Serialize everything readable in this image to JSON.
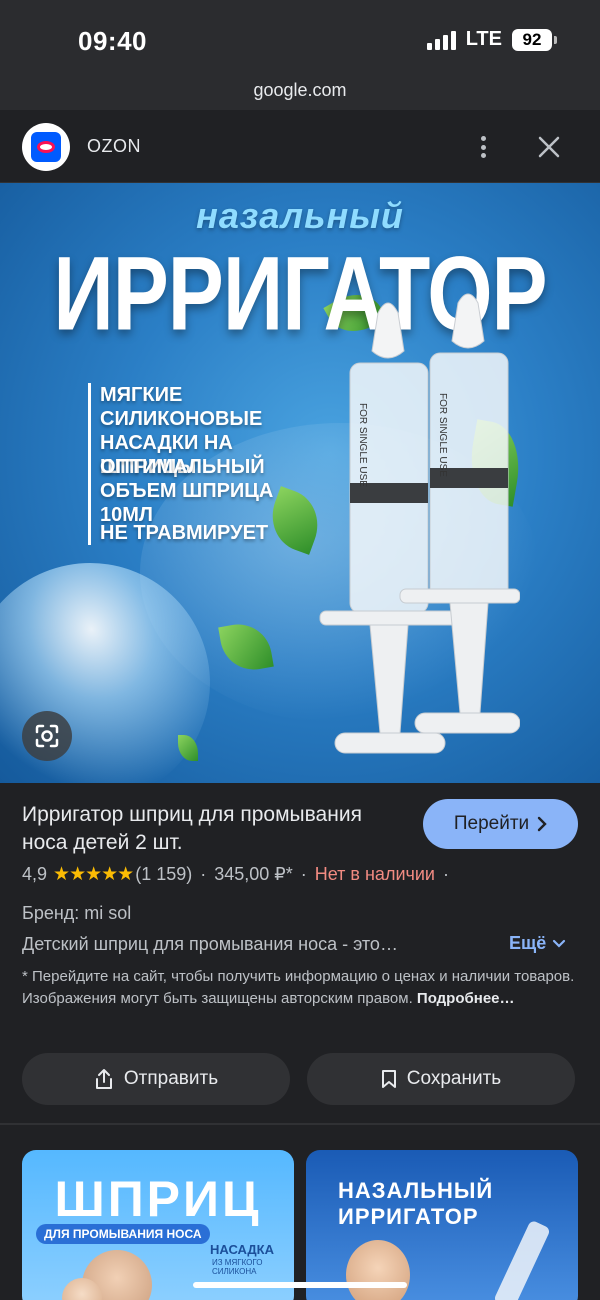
{
  "status_bar": {
    "time": "09:40",
    "network": "LTE",
    "battery": "92"
  },
  "browser": {
    "url": "google.com"
  },
  "header": {
    "site_name": "OZON"
  },
  "hero": {
    "subtitle": "назальный",
    "title": "ИРРИГАТОР",
    "features": [
      "МЯГКИЕ СИЛИКОНОВЫЕ НАСАДКИ НА ШПРИЦЫ",
      "ОПТИМАЛЬНЫЙ ОБЪЕМ ШПРИЦА 10МЛ",
      "НЕ ТРАВМИРУЕТ"
    ],
    "syringe_text": "FOR SINGLE USE"
  },
  "product": {
    "title": "Ирригатор шприц для промывания носа детей 2 шт.",
    "go_label": "Перейти",
    "rating": "4,9",
    "stars": "★★★★★",
    "reviews": "(1 159)",
    "price": "345,00 ₽*",
    "availability": "Нет в наличии",
    "brand": "Бренд: mi sol",
    "description": "Детский шприц для промывания носа - это…",
    "more_label": "Ещё",
    "notice": "* Перейдите на сайт, чтобы получить информацию о ценах и наличии товаров. Изображения могут быть защищены авторским правом.",
    "notice_link": "Подробнее…",
    "share_label": "Отправить",
    "save_label": "Сохранить"
  },
  "related": [
    {
      "title": "ШПРИЦ",
      "subtitle": "ДЛЯ ПРОМЫВАНИЯ НОСА",
      "note": "НАСАДКА",
      "note2": "ИЗ МЯГКОГО СИЛИКОНА"
    },
    {
      "title_line1": "НАЗАЛЬНЫЙ",
      "title_line2": "ИРРИГАТОР"
    }
  ],
  "colors": {
    "accent": "#8ab4f8",
    "out_of_stock": "#f28b82",
    "stars": "#fbbc04",
    "background": "#202124"
  }
}
